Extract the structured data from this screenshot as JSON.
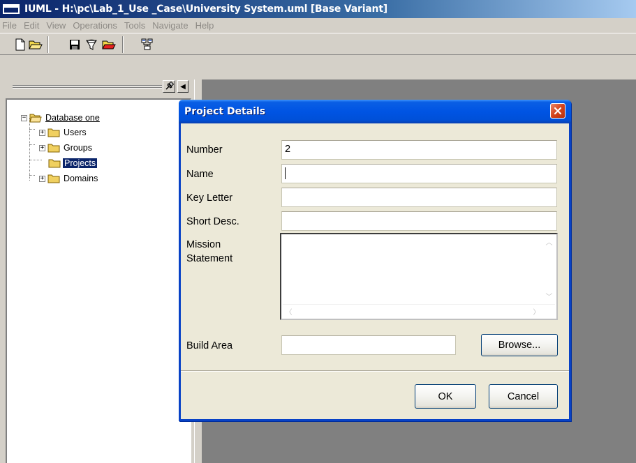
{
  "window": {
    "title": "IUML - H:\\pc\\Lab_1_Use _Case\\University System.uml [Base Variant]"
  },
  "menu": {
    "items": [
      "File",
      "Edit",
      "View",
      "Operations",
      "Tools",
      "Navigate",
      "Help"
    ]
  },
  "toolbar": {
    "buttons": [
      "new-file-icon",
      "open-folder-icon",
      "save-icon",
      "filter-icon",
      "open-red-folder-icon",
      "diagram-icon"
    ]
  },
  "tree": {
    "root": "Database one",
    "items": [
      {
        "label": "Users",
        "expandable": true,
        "selected": false
      },
      {
        "label": "Groups",
        "expandable": true,
        "selected": false
      },
      {
        "label": "Projects",
        "expandable": false,
        "selected": true
      },
      {
        "label": "Domains",
        "expandable": true,
        "selected": false
      }
    ],
    "collapse_symbol": "−",
    "expand_symbol": "+"
  },
  "dialog": {
    "title": "Project Details",
    "fields": {
      "number_label": "Number",
      "number_value": "2",
      "name_label": "Name",
      "name_value": "",
      "key_letter_label": "Key Letter",
      "key_letter_value": "",
      "short_desc_label": "Short Desc.",
      "short_desc_value": "",
      "mission_label_line1": "Mission",
      "mission_label_line2": "Statement",
      "mission_value": "",
      "build_area_label": "Build Area",
      "build_area_value": ""
    },
    "browse_label": "Browse...",
    "ok_label": "OK",
    "cancel_label": "Cancel"
  },
  "colors": {
    "xp_title_blue": "#0054e3",
    "selection_blue": "#0a246a",
    "close_red": "#d4431a",
    "workspace_gray": "#808080"
  }
}
